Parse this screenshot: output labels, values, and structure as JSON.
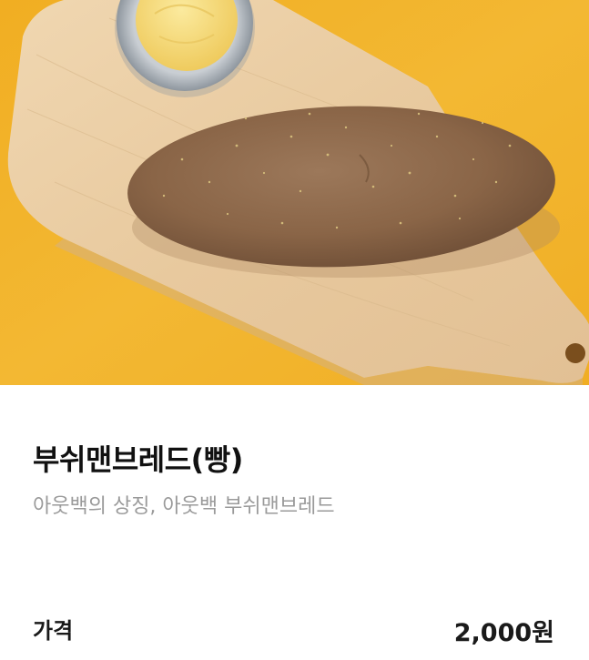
{
  "product": {
    "image_alt": "부쉬맨브레드 빵 사진",
    "name": "부쉬맨브레드(빵)",
    "description": "아웃백의 상징, 아웃백 부쉬맨브레드"
  },
  "price": {
    "label": "가격",
    "value": "2,000원"
  },
  "colors": {
    "background_yellow": "#F2B32A",
    "board_wood": "#E9CDA4",
    "bread_brown": "#8E6A4C",
    "butter": "#F3DA7A",
    "subtitle_gray": "#9A9A9A"
  }
}
